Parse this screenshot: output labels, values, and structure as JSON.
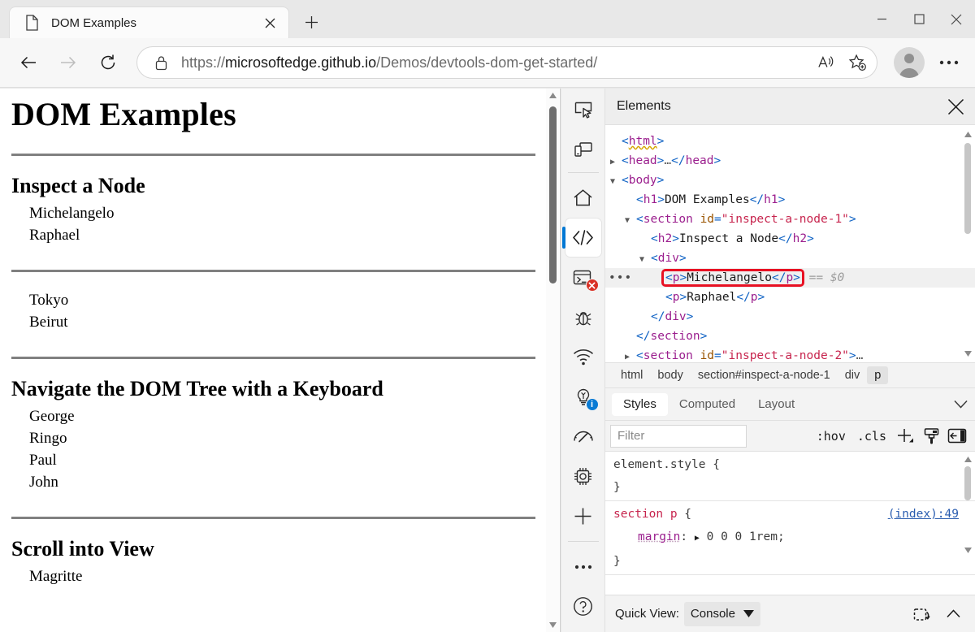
{
  "window": {
    "controls": [
      {
        "name": "minimize-button",
        "glyph": "minimize"
      },
      {
        "name": "maximize-button",
        "glyph": "maximize"
      },
      {
        "name": "close-button",
        "glyph": "close"
      }
    ]
  },
  "tab": {
    "title": "DOM Examples",
    "favicon": "document-icon",
    "close_label": "Close tab",
    "new_tab_label": "New tab"
  },
  "toolbar": {
    "back_label": "Back",
    "forward_label": "Forward",
    "reload_label": "Refresh",
    "lock_icon": "lock-icon",
    "url_full": "https://microsoftedge.github.io/Demos/devtools-dom-get-started/",
    "url_scheme": "https://",
    "url_host": "microsoftedge.github.io",
    "url_path": "/Demos/devtools-dom-get-started/",
    "read_aloud_label": "Read aloud",
    "favorites_label": "Add this page to favorites",
    "profile_label": "Profile",
    "settings_label": "Settings and more"
  },
  "page": {
    "title": "DOM Examples",
    "sections": [
      {
        "heading": "Inspect a Node",
        "items": [
          "Michelangelo",
          "Raphael"
        ]
      },
      {
        "heading": "",
        "items": [
          "Tokyo",
          "Beirut"
        ]
      },
      {
        "heading": "Navigate the DOM Tree with a Keyboard",
        "items": [
          "George",
          "Ringo",
          "Paul",
          "John"
        ]
      },
      {
        "heading": "Scroll into View",
        "items": [
          "Magritte"
        ]
      }
    ]
  },
  "devtools": {
    "panel_title": "Elements",
    "close_label": "Close DevTools",
    "activity_bar": [
      {
        "name": "inspect-element-icon",
        "label": "Inspect",
        "badge": null,
        "selected": false
      },
      {
        "name": "device-emulation-icon",
        "label": "Toggle device emulation",
        "badge": null,
        "selected": false
      },
      {
        "name": "welcome-home-icon",
        "label": "Welcome",
        "badge": null,
        "selected": false
      },
      {
        "name": "elements-code-icon",
        "label": "Elements",
        "badge": null,
        "selected": true
      },
      {
        "name": "console-icon",
        "label": "Console",
        "badge": "error",
        "selected": false
      },
      {
        "name": "debugger-bug-icon",
        "label": "Sources",
        "badge": null,
        "selected": false
      },
      {
        "name": "network-wifi-icon",
        "label": "Network",
        "badge": null,
        "selected": false
      },
      {
        "name": "issues-lightbulb-icon",
        "label": "Issues",
        "badge": "info",
        "selected": false
      },
      {
        "name": "performance-gauge-icon",
        "label": "Performance",
        "badge": null,
        "selected": false
      },
      {
        "name": "memory-chip-icon",
        "label": "Memory",
        "badge": null,
        "selected": false
      },
      {
        "name": "add-tool-plus-icon",
        "label": "More tools",
        "badge": null,
        "selected": false
      },
      {
        "name": "more-options-icon",
        "label": "More options",
        "badge": null,
        "selected": false
      },
      {
        "name": "help-question-icon",
        "label": "Help",
        "badge": null,
        "selected": false
      }
    ],
    "dom_tree": [
      {
        "indent": 1,
        "twisty": "none",
        "tokens": [
          {
            "t": "pk",
            "v": "<"
          },
          {
            "t": "tag squiggle",
            "v": "html"
          },
          {
            "t": "pk",
            "v": ">"
          }
        ]
      },
      {
        "indent": 1,
        "twisty": "right",
        "tokens": [
          {
            "t": "pk",
            "v": "<"
          },
          {
            "t": "tag",
            "v": "head"
          },
          {
            "t": "pk",
            "v": ">"
          },
          {
            "t": "ell",
            "v": "…"
          },
          {
            "t": "pk",
            "v": "</"
          },
          {
            "t": "tag",
            "v": "head"
          },
          {
            "t": "pk",
            "v": ">"
          }
        ]
      },
      {
        "indent": 1,
        "twisty": "down",
        "tokens": [
          {
            "t": "pk",
            "v": "<"
          },
          {
            "t": "tag",
            "v": "body"
          },
          {
            "t": "pk",
            "v": ">"
          }
        ]
      },
      {
        "indent": 2,
        "twisty": "none",
        "tokens": [
          {
            "t": "pk",
            "v": "<"
          },
          {
            "t": "tag",
            "v": "h1"
          },
          {
            "t": "pk",
            "v": ">"
          },
          {
            "t": "txt",
            "v": "DOM Examples"
          },
          {
            "t": "pk",
            "v": "</"
          },
          {
            "t": "tag",
            "v": "h1"
          },
          {
            "t": "pk",
            "v": ">"
          }
        ]
      },
      {
        "indent": 2,
        "twisty": "down",
        "tokens": [
          {
            "t": "pk",
            "v": "<"
          },
          {
            "t": "tag",
            "v": "section"
          },
          {
            "t": "txt",
            "v": " "
          },
          {
            "t": "attr",
            "v": "id"
          },
          {
            "t": "pk",
            "v": "="
          },
          {
            "t": "val",
            "v": "\"inspect-a-node-1\""
          },
          {
            "t": "pk",
            "v": ">"
          }
        ]
      },
      {
        "indent": 3,
        "twisty": "none",
        "tokens": [
          {
            "t": "pk",
            "v": "<"
          },
          {
            "t": "tag",
            "v": "h2"
          },
          {
            "t": "pk",
            "v": ">"
          },
          {
            "t": "txt",
            "v": "Inspect a Node"
          },
          {
            "t": "pk",
            "v": "</"
          },
          {
            "t": "tag",
            "v": "h2"
          },
          {
            "t": "pk",
            "v": ">"
          }
        ]
      },
      {
        "indent": 3,
        "twisty": "down",
        "tokens": [
          {
            "t": "pk",
            "v": "<"
          },
          {
            "t": "tag",
            "v": "div"
          },
          {
            "t": "pk",
            "v": ">"
          }
        ]
      },
      {
        "indent": 4,
        "twisty": "none",
        "selected": true,
        "suffix": "== $0",
        "tokens": [
          {
            "t": "pk",
            "v": "<"
          },
          {
            "t": "tag",
            "v": "p"
          },
          {
            "t": "pk",
            "v": ">"
          },
          {
            "t": "txt",
            "v": "Michelangelo"
          },
          {
            "t": "pk",
            "v": "</"
          },
          {
            "t": "tag",
            "v": "p"
          },
          {
            "t": "pk",
            "v": ">"
          }
        ]
      },
      {
        "indent": 4,
        "twisty": "none",
        "tokens": [
          {
            "t": "pk",
            "v": "<"
          },
          {
            "t": "tag",
            "v": "p"
          },
          {
            "t": "pk",
            "v": ">"
          },
          {
            "t": "txt",
            "v": "Raphael"
          },
          {
            "t": "pk",
            "v": "</"
          },
          {
            "t": "tag",
            "v": "p"
          },
          {
            "t": "pk",
            "v": ">"
          }
        ]
      },
      {
        "indent": 3,
        "twisty": "none",
        "tokens": [
          {
            "t": "pk",
            "v": "</"
          },
          {
            "t": "tag",
            "v": "div"
          },
          {
            "t": "pk",
            "v": ">"
          }
        ]
      },
      {
        "indent": 2,
        "twisty": "none",
        "tokens": [
          {
            "t": "pk",
            "v": "</"
          },
          {
            "t": "tag",
            "v": "section"
          },
          {
            "t": "pk",
            "v": ">"
          }
        ]
      },
      {
        "indent": 2,
        "twisty": "right",
        "tokens": [
          {
            "t": "pk",
            "v": "<"
          },
          {
            "t": "tag",
            "v": "section"
          },
          {
            "t": "txt",
            "v": " "
          },
          {
            "t": "attr",
            "v": "id"
          },
          {
            "t": "pk",
            "v": "="
          },
          {
            "t": "val",
            "v": "\"inspect-a-node-2\""
          },
          {
            "t": "pk",
            "v": ">"
          },
          {
            "t": "ell",
            "v": "…"
          }
        ]
      },
      {
        "indent": 2,
        "twisty": "none",
        "tokens": [
          {
            "t": "pk",
            "v": "</"
          },
          {
            "t": "tag",
            "v": "section"
          },
          {
            "t": "pk",
            "v": ">"
          }
        ]
      }
    ],
    "row_menu_dots": "•••",
    "breadcrumb": [
      {
        "label": "html",
        "active": false
      },
      {
        "label": "body",
        "active": false
      },
      {
        "label": "section#inspect-a-node-1",
        "active": false
      },
      {
        "label": "div",
        "active": false
      },
      {
        "label": "p",
        "active": true
      }
    ],
    "style_tabs": [
      {
        "label": "Styles",
        "active": true
      },
      {
        "label": "Computed",
        "active": false
      },
      {
        "label": "Layout",
        "active": false
      }
    ],
    "style_tabs_more": "chevron-down-icon",
    "filter": {
      "placeholder": "Filter",
      "value": "",
      "hov_label": ":hov",
      "cls_label": ".cls",
      "new_rule_label": "New style rule",
      "color_picker_label": "Element classes",
      "sidebar_toggle_label": "Toggle sidebar"
    },
    "style_rules": [
      {
        "selector": "element.style",
        "source": "",
        "declarations": []
      },
      {
        "selector": "section p",
        "source": "(index):49",
        "declarations": [
          {
            "property": "margin",
            "value": "0 0 0 1rem",
            "expandable": true
          }
        ]
      }
    ],
    "quick_view": {
      "label": "Quick View:",
      "selected": "Console",
      "dropdown_icon": "caret-down-icon",
      "undock_label": "Dock side",
      "collapse_label": "Collapse"
    }
  },
  "colors": {
    "accent": "#0078d4",
    "error": "#d93025",
    "info": "#0a7bd4",
    "selection_outline": "#e81123",
    "tag": "#9b1f8e",
    "punctuation": "#0f62c4",
    "attribute": "#9a5400",
    "attribute_value": "#c7254e",
    "link": "#2a5db0"
  }
}
